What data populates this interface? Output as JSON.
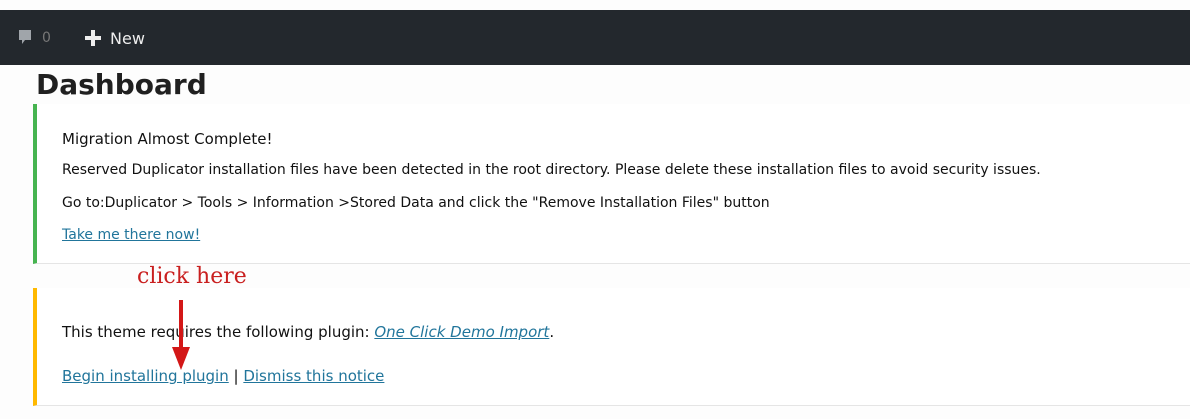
{
  "admin_bar": {
    "comment_count": "0",
    "new_label": "New"
  },
  "page": {
    "title": "Dashboard"
  },
  "notices": {
    "migration": {
      "title": "Migration Almost Complete!",
      "message": "Reserved Duplicator installation files have been detected in the root directory. Please delete these installation files to avoid security issues.",
      "instruction": "Go to:Duplicator > Tools > Information >Stored Data and click the \"Remove Installation Files\" button",
      "link_label": "Take me there now!"
    },
    "plugin": {
      "message_prefix": "This theme requires the following plugin: ",
      "plugin_name": "One Click Demo Import",
      "message_suffix": ".",
      "begin_install_label": "Begin installing plugin",
      "separator": " | ",
      "dismiss_label": "Dismiss this notice"
    }
  },
  "annotation": {
    "text": "click here",
    "color": "#c91f1f"
  },
  "colors": {
    "admin_bar": "#23282d",
    "success": "#46b450",
    "warning": "#ffb900",
    "link": "#21759b"
  },
  "icons": {
    "comments": "comment-bubble-icon",
    "new": "plus-icon",
    "annotation_arrow": "arrow-down-icon"
  }
}
